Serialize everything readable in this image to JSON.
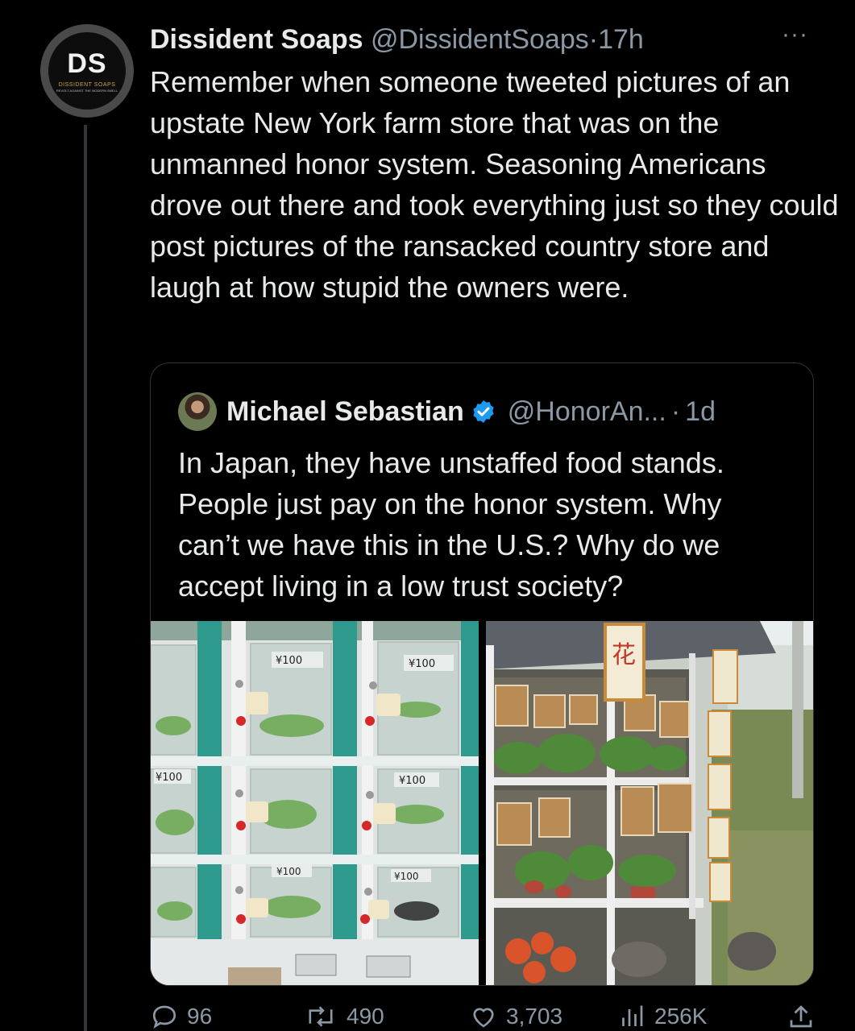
{
  "author": {
    "avatar_initials": "DS",
    "avatar_subtitle": "DISSIDENT SOAPS",
    "avatar_tagline": "REVOLT AGAINST THE MODERN SMELL",
    "name": "Dissident Soaps",
    "handle": "@DissidentSoaps",
    "time": "17h",
    "separator": "·"
  },
  "more_label": "···",
  "tweet_text": "Remember when someone tweeted pictures of an upstate New York farm store that was on the unmanned honor system. Seasoning Americans drove out there and took everything just so they could post pictures of the ransacked country store and laugh at how stupid the owners were.",
  "quote": {
    "name": "Michael Sebastian",
    "handle": "@HonorAn...",
    "time": "1d",
    "separator": "·",
    "text": "In Japan, they have unstaffed food stands. People just pay on the honor system. Why can’t we have this in the U.S.? Why do we accept living in a low trust society?",
    "locker_prices": [
      "¥100",
      "¥100",
      "¥100",
      "¥100",
      "¥100",
      "¥100"
    ],
    "stand_sign": "花"
  },
  "stats": {
    "replies": "96",
    "retweets": "490",
    "likes": "3,703",
    "views": "256K"
  },
  "colors": {
    "background": "#000000",
    "text": "#e7e9ea",
    "muted": "#8b98a5",
    "border": "#2f3336",
    "verified": "#1d9bf0"
  },
  "icons": [
    "more-icon",
    "verified-icon",
    "reply-icon",
    "retweet-icon",
    "like-icon",
    "views-icon",
    "share-icon"
  ]
}
